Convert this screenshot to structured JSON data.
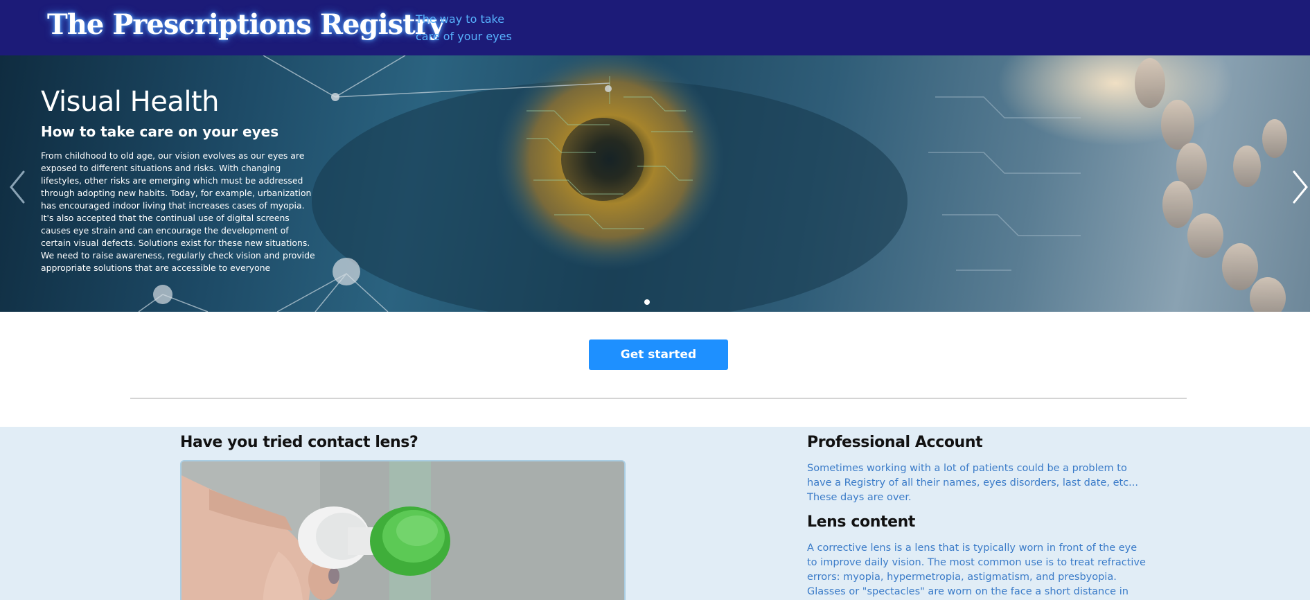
{
  "header": {
    "brand": "The Prescriptions Registry",
    "tagline": "The way to take care of your eyes",
    "background_color": "#1c1b78",
    "tagline_color": "#58b4ff"
  },
  "hero": {
    "title": "Visual Health",
    "subtitle": "How to take care on your eyes",
    "text": "From childhood to old age, our vision evolves as our eyes are exposed to different situations and risks. With changing lifestyles, other risks are emerging which must be addressed through adopting new habits. Today, for example, urbanization has encouraged indoor living that increases cases of myopia. It's also accepted that the continual use of digital screens causes eye strain and can encourage the development of certain visual defects. Solutions exist for these new situations. We need to raise awareness, regularly check vision and provide appropriate solutions that are accessible to everyone",
    "prev_icon": "chevron-left-icon",
    "next_icon": "chevron-right-icon",
    "slide_count": 1,
    "active_slide": 1
  },
  "cta": {
    "label": "Get started",
    "color": "#1e90ff"
  },
  "info": {
    "background_color": "#e1edf6",
    "contact": {
      "heading": "Have you tried contact lens?",
      "image": "contact-lens-case-photo"
    },
    "professional": {
      "heading": "Professional Account",
      "text": "Sometimes working with a lot of patients could be a problem to have a Registry of all their names, eyes disorders, last date, etc... These days are over."
    },
    "lens": {
      "heading": "Lens content",
      "text": "A corrective lens is a lens that is typically worn in front of the eye to improve daily vision. The most common use is to treat refractive errors: myopia, hypermetropia, astigmatism, and presbyopia. Glasses or \"spectacles\" are worn on the face a short distance in"
    },
    "text_color": "#3a7bc8"
  }
}
